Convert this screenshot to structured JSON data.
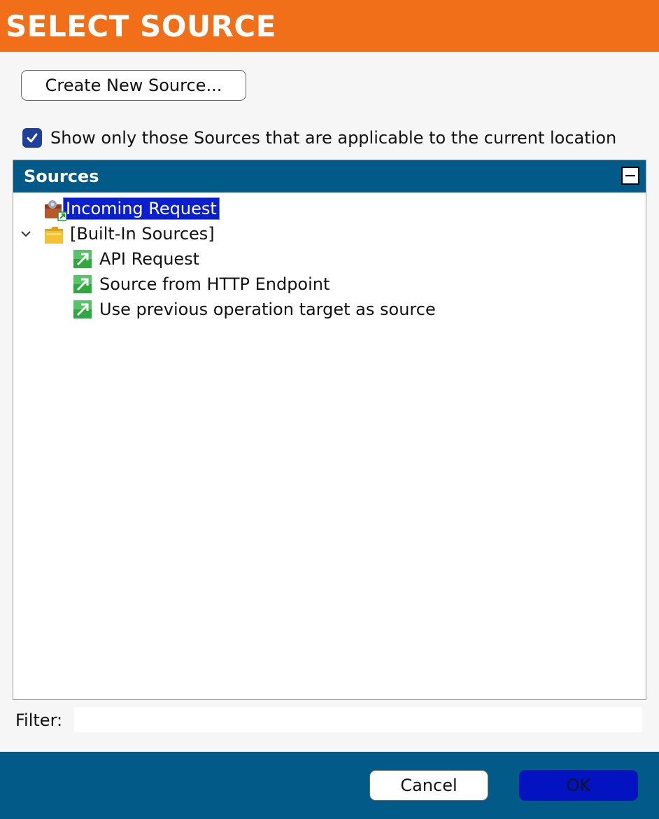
{
  "dialog": {
    "title": "SELECT SOURCE"
  },
  "toolbar": {
    "create_label": "Create New Source..."
  },
  "filter_option": {
    "checked": true,
    "label": "Show only those Sources that are applicable to the current location"
  },
  "panel": {
    "title": "Sources",
    "tree": [
      {
        "label": "Incoming Request",
        "icon": "incoming-request-icon",
        "selected": true,
        "level": 0
      },
      {
        "label": "[Built-In Sources]",
        "icon": "folder-icon",
        "expanded": true,
        "level": 0
      },
      {
        "label": "API Request",
        "icon": "source-arrow-icon",
        "level": 1
      },
      {
        "label": "Source from HTTP Endpoint",
        "icon": "source-arrow-icon",
        "level": 1
      },
      {
        "label": "Use previous operation target as source",
        "icon": "source-arrow-icon",
        "level": 1
      }
    ]
  },
  "filter": {
    "label": "Filter:",
    "value": ""
  },
  "footer": {
    "cancel_label": "Cancel",
    "ok_label": "OK"
  },
  "colors": {
    "title_bar": "#f26f1a",
    "header": "#015a87",
    "selection": "#0a1fd0",
    "ok_button": "#0313c2"
  }
}
